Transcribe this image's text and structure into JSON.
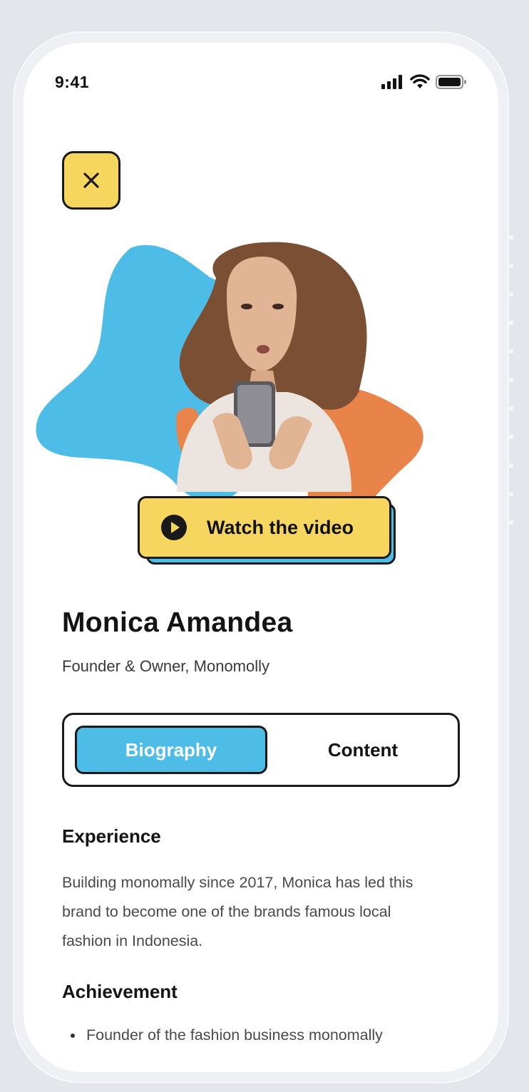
{
  "status_bar": {
    "time": "9:41"
  },
  "hero": {
    "close_icon": "close-icon",
    "video_button_label": "Watch the video",
    "play_icon": "play-icon",
    "colors": {
      "accent_yellow": "#f7d660",
      "accent_blue": "#4dbde8",
      "accent_orange": "#e8844a"
    }
  },
  "profile": {
    "name": "Monica Amandea",
    "role": "Founder & Owner, Monomolly"
  },
  "tabs": [
    {
      "label": "Biography",
      "active": true
    },
    {
      "label": "Content",
      "active": false
    }
  ],
  "biography": {
    "experience_title": "Experience",
    "experience_lines": [
      "Building monomally since 2017, Monica has led this",
      "brand to become one of the brands famous local",
      "fashion in Indonesia."
    ],
    "achievement_title": "Achievement",
    "achievements": [
      "Founder of the fashion business monomally"
    ]
  }
}
